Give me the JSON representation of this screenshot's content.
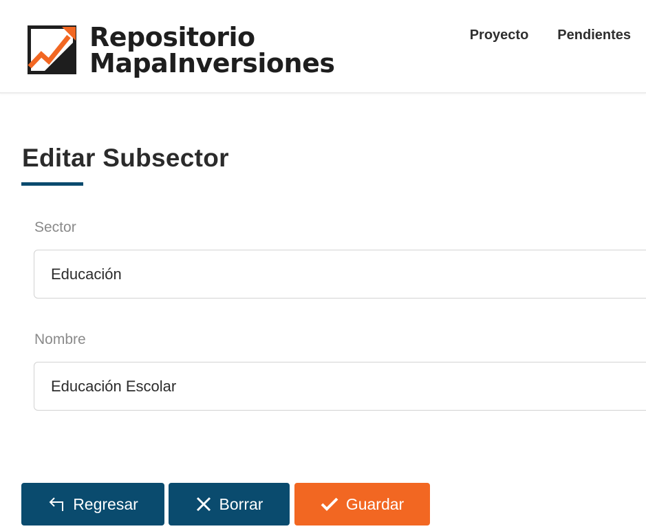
{
  "header": {
    "logo_line1": "Repositorio",
    "logo_line2": "MapaInversiones",
    "nav": [
      {
        "label": "Proyecto"
      },
      {
        "label": "Pendientes"
      }
    ]
  },
  "page": {
    "title": "Editar Subsector"
  },
  "form": {
    "sector": {
      "label": "Sector",
      "value": "Educación"
    },
    "nombre": {
      "label": "Nombre",
      "value": "Educación Escolar"
    }
  },
  "actions": {
    "back": {
      "label": "Regresar",
      "icon": "return-arrow-icon"
    },
    "delete": {
      "label": "Borrar",
      "icon": "close-icon"
    },
    "save": {
      "label": "Guardar",
      "icon": "check-icon"
    }
  },
  "colors": {
    "primary": "#0a4b6e",
    "accent": "#f26722",
    "logo_dark": "#1e1e1e"
  }
}
